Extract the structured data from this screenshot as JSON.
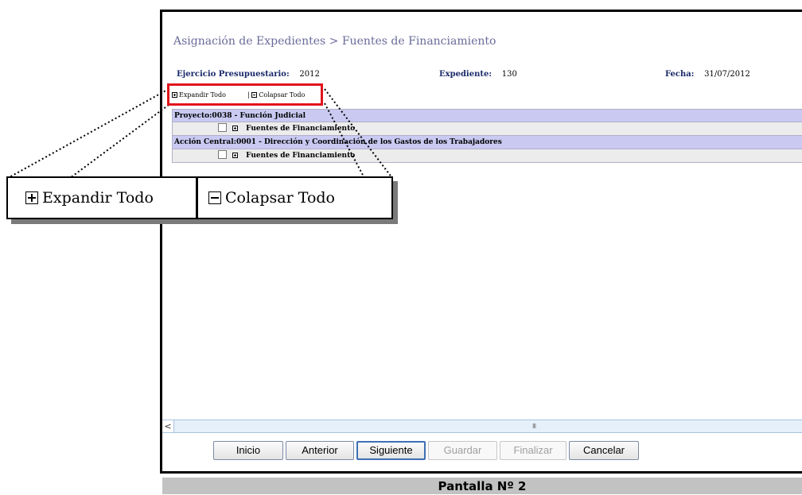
{
  "title": "Asignación de Expedientes > Fuentes de Financiamiento",
  "meta": {
    "ejercicio_label": "Ejercicio Presupuestario:",
    "ejercicio_value": "2012",
    "expediente_label": "Expediente:",
    "expediente_value": "130",
    "fecha_label": "Fecha:",
    "fecha_value": "31/07/2012"
  },
  "toolbar": {
    "expand_label": "Expandir Todo",
    "separator": "|",
    "collapse_label": "Colapsar Todo"
  },
  "tree": [
    {
      "header": "Proyecto:0038 - Función Judicial",
      "child": "Fuentes de Financiamiento"
    },
    {
      "header": "Acción Central:0001 - Dirección y Coordinación de los Gastos de los Trabajadores",
      "child": "Fuentes de Financiamiento"
    }
  ],
  "callout": {
    "expand_label": "Expandir Todo",
    "collapse_label": "Colapsar Todo"
  },
  "buttons": [
    {
      "label": "Inicio",
      "state": "normal"
    },
    {
      "label": "Anterior",
      "state": "normal"
    },
    {
      "label": "Siguiente",
      "state": "focused"
    },
    {
      "label": "Guardar",
      "state": "disabled"
    },
    {
      "label": "Finalizar",
      "state": "disabled"
    },
    {
      "label": "Cancelar",
      "state": "normal"
    }
  ],
  "scrollbar": {
    "left_arrow": "<",
    "grip": "III"
  },
  "caption": "Pantalla Nº 2",
  "colors": {
    "title": "#6a6a9a",
    "tree_header_bg": "#c9c9f2",
    "tree_child_bg": "#ececec",
    "highlight_box": "#e0141c",
    "caption_bg": "#c2c2c2"
  },
  "icons": {
    "expand": "plus-square-icon",
    "collapse": "minus-square-icon"
  }
}
